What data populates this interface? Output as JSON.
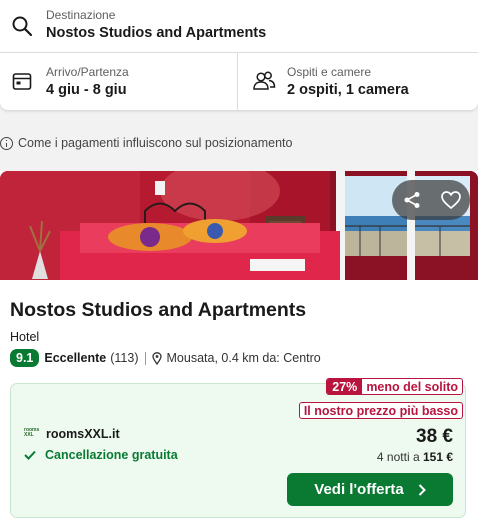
{
  "search": {
    "destination": {
      "label": "Destinazione",
      "value": "Nostos Studios and Apartments",
      "icon": "search-icon"
    },
    "dates": {
      "label": "Arrivo/Partenza",
      "value": "4 giu - 8 giu",
      "icon": "calendar-icon"
    },
    "guests": {
      "label": "Ospiti e camere",
      "value": "2 ospiti, 1 camera",
      "icon": "guests-icon"
    }
  },
  "info": {
    "text": "Come i pagamenti influiscono sul posizionamento",
    "icon": "info-icon"
  },
  "hotel": {
    "name": "Nostos Studios and Apartments",
    "type": "Hotel",
    "rating": {
      "score": "9.1",
      "label": "Eccellente",
      "count": "(113)"
    },
    "location": "Mousata, 0.4 km da: Centro",
    "photo_alt": "Room with red walls and bed",
    "share_icon": "share-icon",
    "favorite_icon": "heart-icon"
  },
  "offer": {
    "discount_pct": "27%",
    "discount_text": "meno del solito",
    "best_price_text": "Il nostro prezzo più basso",
    "provider_logo_text": "rooms XXL",
    "provider": "roomsXXL.it",
    "cancellation": "Cancellazione gratuita",
    "price": "38 €",
    "nights_prefix": "4 notti a",
    "total": "151 €",
    "cta_label": "Vedi l'offerta"
  },
  "colors": {
    "accent_green": "#0a7a33",
    "deal_red": "#b8143e",
    "offer_bg": "#eefaf0"
  }
}
